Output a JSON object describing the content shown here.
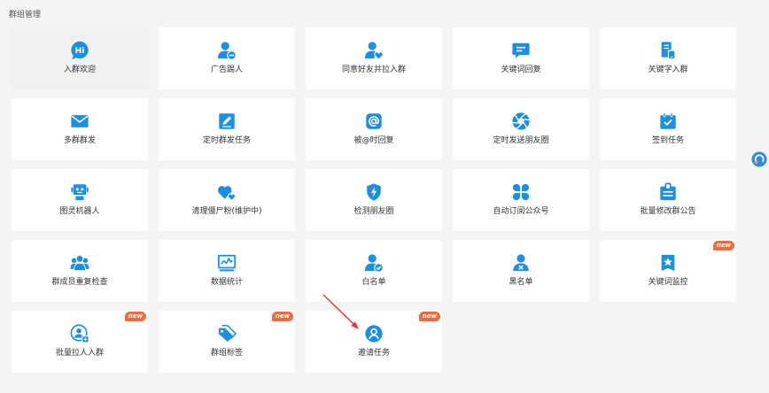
{
  "page": {
    "title": "群组管理"
  },
  "colors": {
    "accent": "#1a8fe3",
    "badge": "#f26a3d",
    "tile_bg": "#ffffff",
    "tile_active_bg": "#f1f1f1",
    "page_bg": "#f4f4f4",
    "label": "#333333",
    "annotation_arrow": "#e53935"
  },
  "tiles": [
    {
      "label": "入群欢迎",
      "icon": "hi-bubble-icon",
      "icon_text": "Hi",
      "highlighted": true
    },
    {
      "label": "广告踢人",
      "icon": "remove-user-icon"
    },
    {
      "label": "同意好友并拉入群",
      "icon": "user-heart-icon"
    },
    {
      "label": "关键词回复",
      "icon": "chat-bubble-icon"
    },
    {
      "label": "关键字入群",
      "icon": "mobile-document-icon"
    },
    {
      "label": "多群群发",
      "icon": "envelope-icon"
    },
    {
      "label": "定时群发任务",
      "icon": "edit-icon"
    },
    {
      "label": "被@时回复",
      "icon": "at-sign-icon"
    },
    {
      "label": "定时发送朋友圈",
      "icon": "aperture-icon"
    },
    {
      "label": "签到任务",
      "icon": "calendar-check-icon"
    },
    {
      "label": "图灵机器人",
      "icon": "robot-icon"
    },
    {
      "label": "清理僵尸粉(维护中)",
      "icon": "hearts-icon"
    },
    {
      "label": "检测朋友圈",
      "icon": "shield-bolt-icon"
    },
    {
      "label": "自动订阅公众号",
      "icon": "clover-icon"
    },
    {
      "label": "批量修改群公告",
      "icon": "clipboard-icon"
    },
    {
      "label": "群成员重复检查",
      "icon": "users-icon"
    },
    {
      "label": "数据统计",
      "icon": "monitor-chart-icon"
    },
    {
      "label": "白名单",
      "icon": "user-check-icon"
    },
    {
      "label": "黑名单",
      "icon": "user-block-icon"
    },
    {
      "label": "关键词监控",
      "icon": "bookmark-star-icon",
      "badge": "new"
    },
    {
      "label": "批量拉人入群",
      "icon": "user-circle-add-icon",
      "badge": "new"
    },
    {
      "label": "群组标签",
      "icon": "tags-icon",
      "badge": "new"
    },
    {
      "label": "邀请任务",
      "icon": "user-circle-icon",
      "badge": "new"
    }
  ]
}
